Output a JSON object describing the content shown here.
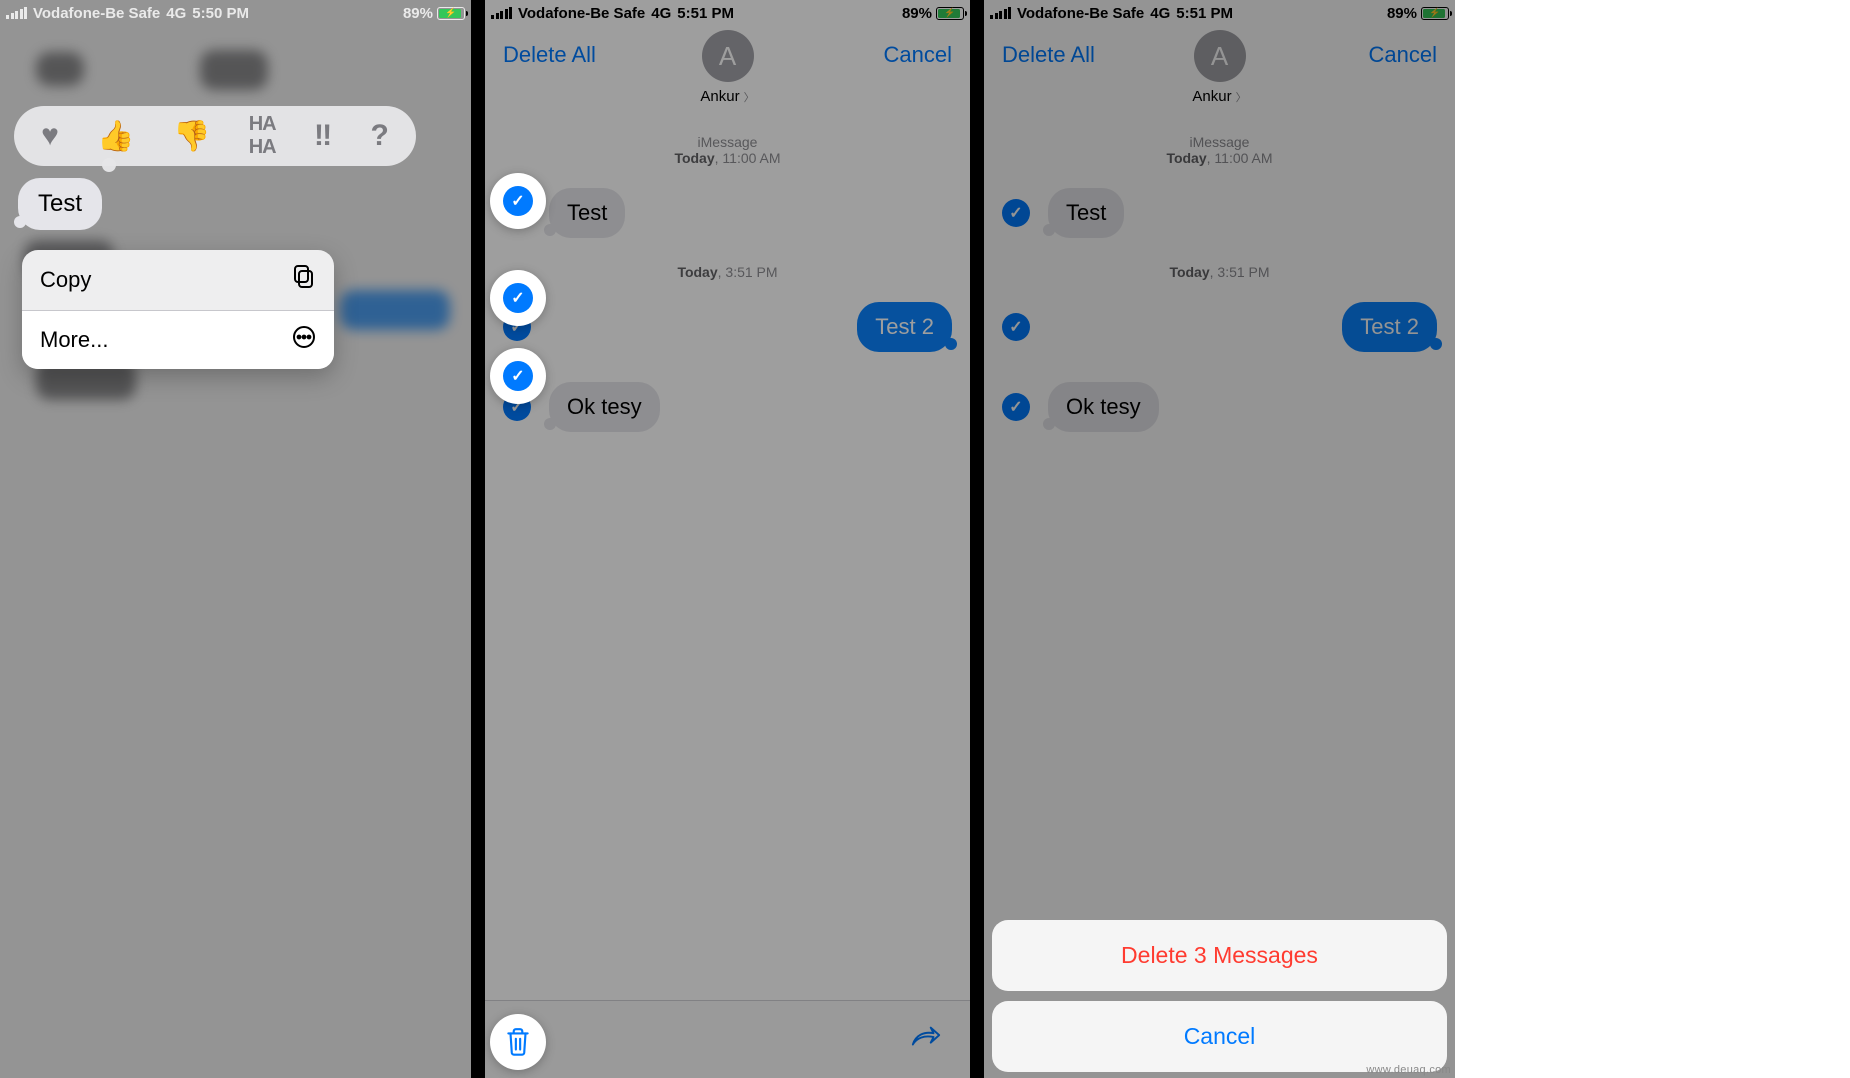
{
  "status": {
    "carrier": "Vodafone-Be Safe",
    "network": "4G",
    "battery": "89%"
  },
  "panel1": {
    "time": "5:50 PM",
    "selected_bubble": "Test",
    "context_menu": {
      "copy": "Copy",
      "more": "More..."
    },
    "reactions": [
      "heart",
      "thumbs-up",
      "thumbs-down",
      "haha",
      "exclaim",
      "question"
    ]
  },
  "panel2": {
    "time": "5:51 PM",
    "nav": {
      "left": "Delete All",
      "right": "Cancel",
      "contact": "Ankur",
      "avatar_initial": "A"
    },
    "header1": {
      "line1": "iMessage",
      "line2_strong": "Today",
      "line2_rest": ", 11:00 AM"
    },
    "header2": {
      "strong": "Today",
      "rest": ", 3:51 PM"
    },
    "msgs": {
      "m1": "Test",
      "m2": "Test 2",
      "m3": "Ok tesy"
    }
  },
  "panel3": {
    "time": "5:51 PM",
    "nav": {
      "left": "Delete All",
      "right": "Cancel",
      "contact": "Ankur",
      "avatar_initial": "A"
    },
    "header1": {
      "line1": "iMessage",
      "line2_strong": "Today",
      "line2_rest": ", 11:00 AM"
    },
    "header2": {
      "strong": "Today",
      "rest": ", 3:51 PM"
    },
    "msgs": {
      "m1": "Test",
      "m2": "Test 2",
      "m3": "Ok tesy"
    },
    "sheet": {
      "delete": "Delete 3 Messages",
      "cancel": "Cancel"
    }
  },
  "watermark": "www.deuaq.com"
}
